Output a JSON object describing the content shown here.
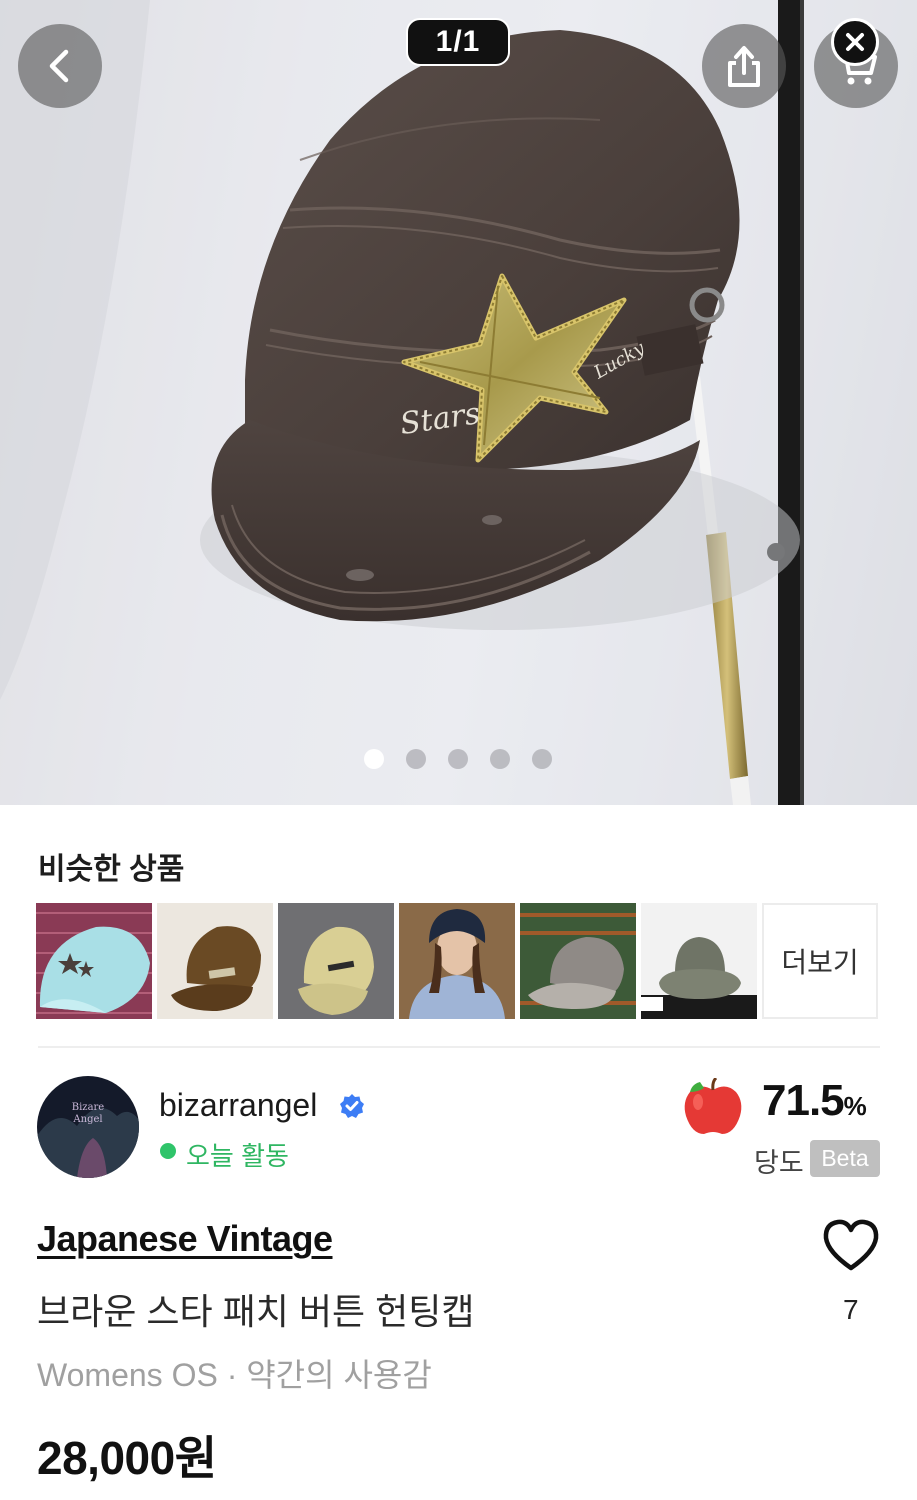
{
  "viewer": {
    "counter": "1/1",
    "icons": {
      "back": "chevron-left-icon",
      "share": "share-icon",
      "cart": "cart-icon",
      "close": "close-icon"
    },
    "carousel_total": 5,
    "carousel_active": 1
  },
  "similar": {
    "title": "비슷한 상품",
    "more_label": "더보기",
    "items": [
      {
        "name": "mint-star-cap"
      },
      {
        "name": "brown-cadet-cap"
      },
      {
        "name": "khaki-cap"
      },
      {
        "name": "person-navy-cap"
      },
      {
        "name": "grey-cap"
      },
      {
        "name": "bucket-hat"
      }
    ]
  },
  "seller": {
    "name": "bizarrangel",
    "status": "오늘 활동",
    "rating_value": "71.5",
    "rating_unit": "%",
    "rating_label": "당도",
    "beta_label": "Beta",
    "avatar_text": [
      "Bizare",
      "Angel"
    ]
  },
  "product": {
    "brand": "Japanese Vintage",
    "title": "브라운 스타 패치 버튼 헌팅캡",
    "meta": "Womens OS · 약간의 사용감",
    "price": "28,000원",
    "likes": "7",
    "photo_text": [
      "Stars",
      "Lucky"
    ]
  },
  "colors": {
    "verified": "#3d7df5",
    "active": "#2fc46a",
    "apple": "#e53935",
    "cap": "#4a3f3b",
    "star_patch": "#b4a24d"
  }
}
